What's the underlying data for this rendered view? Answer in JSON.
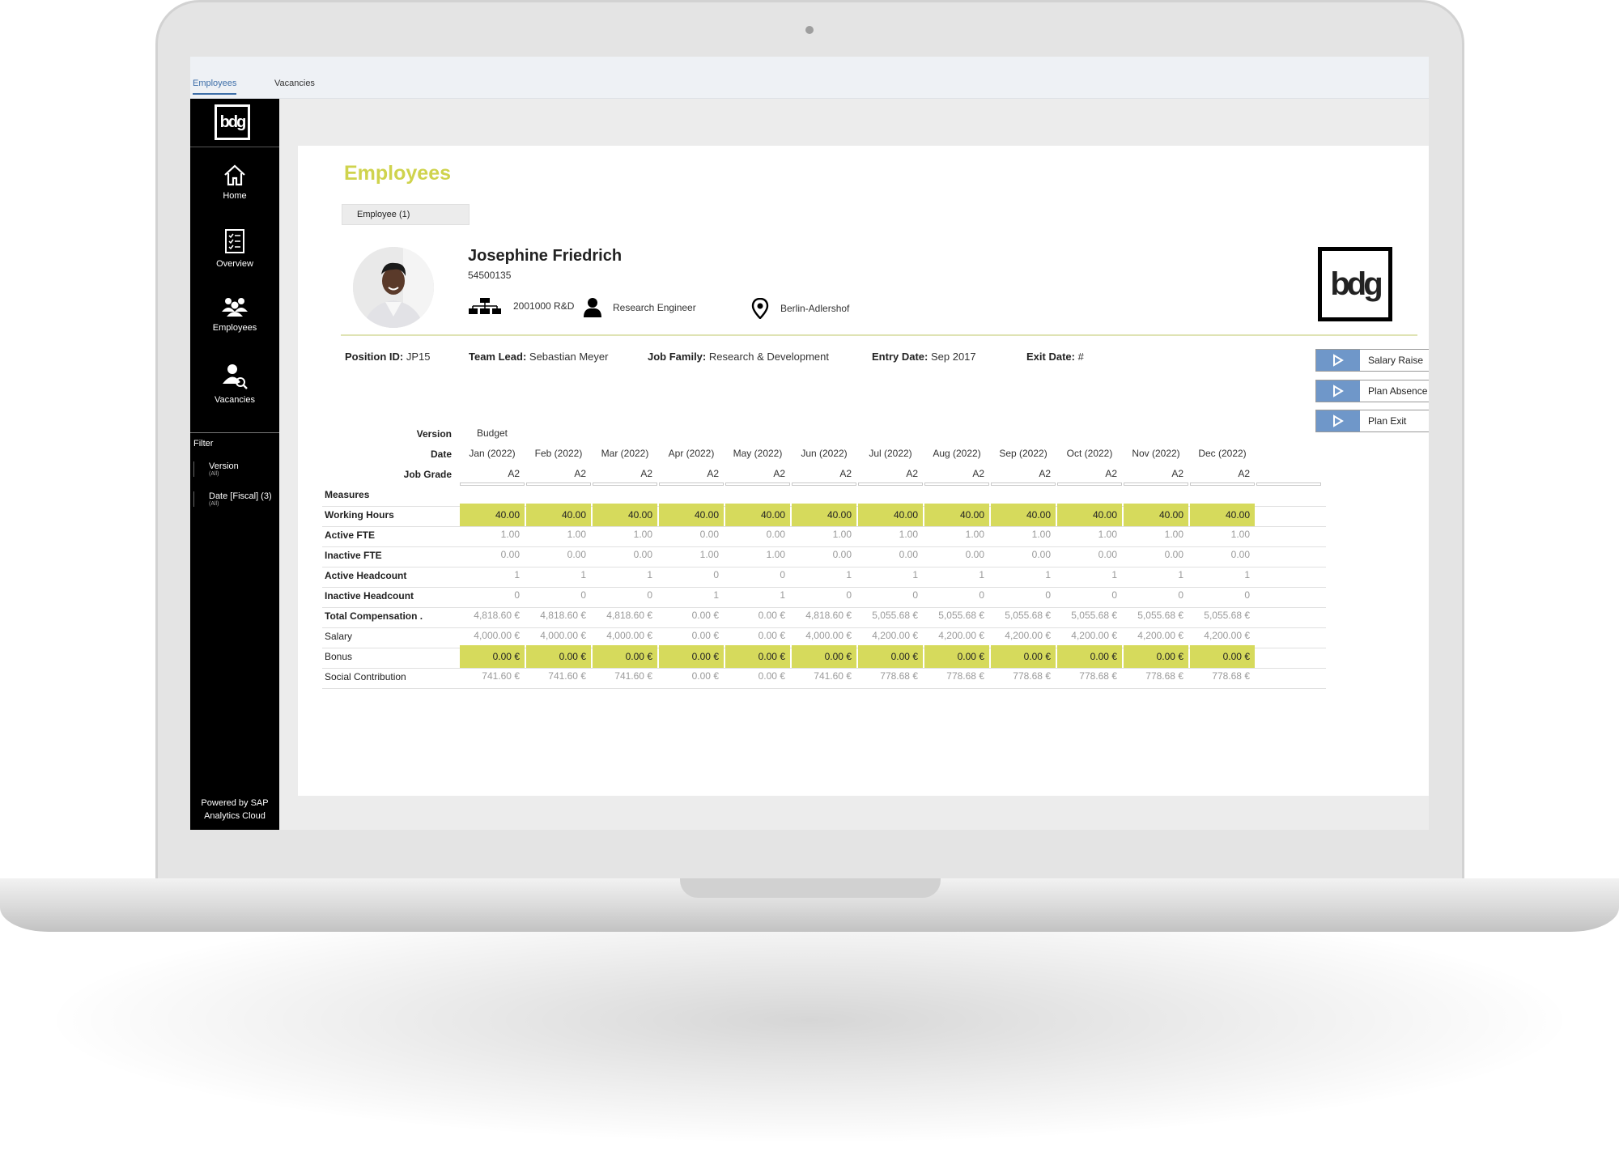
{
  "top_tabs": [
    {
      "label": "Employees",
      "active": true
    },
    {
      "label": "Vacancies",
      "active": false
    }
  ],
  "sidebar": {
    "logo_text": "bdg",
    "items": [
      {
        "label": "Home",
        "icon": "home-icon"
      },
      {
        "label": "Overview",
        "icon": "checklist-icon"
      },
      {
        "label": "Employees",
        "icon": "people-icon"
      },
      {
        "label": "Vacancies",
        "icon": "person-search-icon"
      }
    ],
    "filter_title": "Filter",
    "filters": [
      {
        "name": "Version",
        "sub": "(All)"
      },
      {
        "name": "Date [Fiscal] (3)",
        "sub": "(All)"
      }
    ],
    "powered_by": "Powered by SAP Analytics Cloud"
  },
  "page": {
    "title": "Employees",
    "employee_chip": "Employee (1)",
    "brand_logo": "bdg"
  },
  "employee": {
    "name": "Josephine Friedrich",
    "id": "54500135",
    "department": "2001000 R&D",
    "role": "Research Engineer",
    "location": "Berlin-Adlershof",
    "position_id_label": "Position ID:",
    "position_id": "JP15",
    "team_lead_label": "Team Lead:",
    "team_lead": "Sebastian Meyer",
    "job_family_label": "Job Family:",
    "job_family": "Research & Development",
    "entry_date_label": "Entry Date:",
    "entry_date": "Sep 2017",
    "exit_date_label": "Exit Date:",
    "exit_date": "#"
  },
  "actions": [
    {
      "label": "Salary Raise"
    },
    {
      "label": "Plan Absence"
    },
    {
      "label": "Plan Exit"
    }
  ],
  "table": {
    "version_label": "Version",
    "version_value": "Budget",
    "date_label": "Date",
    "months": [
      "Jan (2022)",
      "Feb (2022)",
      "Mar (2022)",
      "Apr (2022)",
      "May (2022)",
      "Jun (2022)",
      "Jul (2022)",
      "Aug (2022)",
      "Sep (2022)",
      "Oct (2022)",
      "Nov (2022)",
      "Dec (2022)"
    ],
    "job_grade_label": "Job Grade",
    "job_grades": [
      "A2",
      "A2",
      "A2",
      "A2",
      "A2",
      "A2",
      "A2",
      "A2",
      "A2",
      "A2",
      "A2",
      "A2"
    ],
    "measures_label": "Measures",
    "rows": [
      {
        "label": "Working Hours",
        "bold": true,
        "highlight": true,
        "values": [
          "40.00",
          "40.00",
          "40.00",
          "40.00",
          "40.00",
          "40.00",
          "40.00",
          "40.00",
          "40.00",
          "40.00",
          "40.00",
          "40.00"
        ]
      },
      {
        "label": "Active FTE",
        "bold": true,
        "highlight": false,
        "values": [
          "1.00",
          "1.00",
          "1.00",
          "0.00",
          "0.00",
          "1.00",
          "1.00",
          "1.00",
          "1.00",
          "1.00",
          "1.00",
          "1.00"
        ]
      },
      {
        "label": "Inactive FTE",
        "bold": true,
        "highlight": false,
        "values": [
          "0.00",
          "0.00",
          "0.00",
          "1.00",
          "1.00",
          "0.00",
          "0.00",
          "0.00",
          "0.00",
          "0.00",
          "0.00",
          "0.00"
        ]
      },
      {
        "label": "Active Headcount",
        "bold": true,
        "highlight": false,
        "values": [
          "1",
          "1",
          "1",
          "0",
          "0",
          "1",
          "1",
          "1",
          "1",
          "1",
          "1",
          "1"
        ]
      },
      {
        "label": "Inactive Headcount",
        "bold": true,
        "highlight": false,
        "values": [
          "0",
          "0",
          "0",
          "1",
          "1",
          "0",
          "0",
          "0",
          "0",
          "0",
          "0",
          "0"
        ]
      },
      {
        "label": "Total Compensation .",
        "bold": true,
        "highlight": false,
        "values": [
          "4,818.60 €",
          "4,818.60 €",
          "4,818.60 €",
          "0.00 €",
          "0.00 €",
          "4,818.60 €",
          "5,055.68 €",
          "5,055.68 €",
          "5,055.68 €",
          "5,055.68 €",
          "5,055.68 €",
          "5,055.68 €"
        ]
      },
      {
        "label": "Salary",
        "bold": false,
        "highlight": false,
        "values": [
          "4,000.00 €",
          "4,000.00 €",
          "4,000.00 €",
          "0.00 €",
          "0.00 €",
          "4,000.00 €",
          "4,200.00 €",
          "4,200.00 €",
          "4,200.00 €",
          "4,200.00 €",
          "4,200.00 €",
          "4,200.00 €"
        ]
      },
      {
        "label": "Bonus",
        "bold": false,
        "highlight": true,
        "values": [
          "0.00 €",
          "0.00 €",
          "0.00 €",
          "0.00 €",
          "0.00 €",
          "0.00 €",
          "0.00 €",
          "0.00 €",
          "0.00 €",
          "0.00 €",
          "0.00 €",
          "0.00 €"
        ]
      },
      {
        "label": "Social Contribution",
        "bold": false,
        "highlight": false,
        "values": [
          "741.60 €",
          "741.60 €",
          "741.60 €",
          "0.00 €",
          "0.00 €",
          "741.60 €",
          "778.68 €",
          "778.68 €",
          "778.68 €",
          "778.68 €",
          "778.68 €",
          "778.68 €"
        ]
      }
    ]
  },
  "colors": {
    "accent_yellow": "#d6da5c",
    "title_yellow": "#cfd34d",
    "button_blue": "#6f97c9",
    "sidebar_bg": "#000000"
  }
}
